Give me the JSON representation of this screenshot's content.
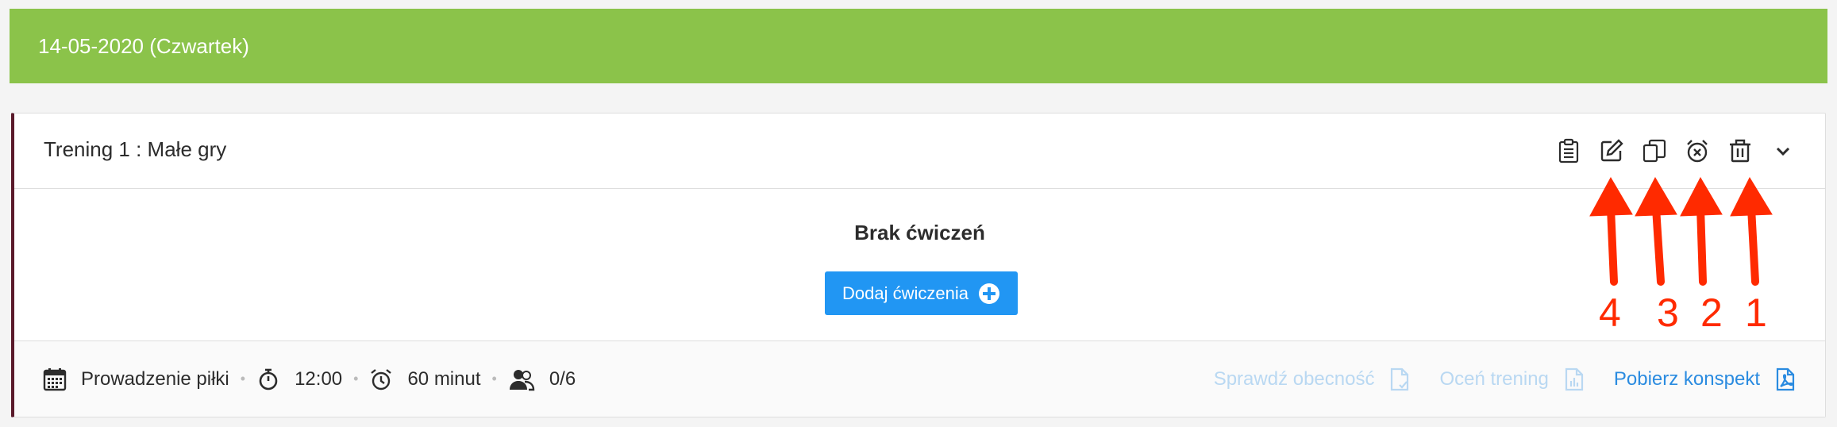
{
  "date_banner": {
    "text": "14-05-2020 (Czwartek)",
    "color": "#8bc34a"
  },
  "training": {
    "title": "Trening 1 : Małe gry",
    "accent_color": "#5a1a2b",
    "header_icons": [
      "clipboard-icon",
      "edit-icon",
      "copy-icon",
      "alarm-cancel-icon",
      "trash-icon",
      "chevron-down-icon"
    ],
    "empty_message": "Brak ćwiczeń",
    "add_button_label": "Dodaj ćwiczenia",
    "footer": {
      "category": "Prowadzenie piłki",
      "time": "12:00",
      "duration": "60 minut",
      "participants": "0/6",
      "check_attendance": "Sprawdź obecność",
      "rate_training": "Oceń trening",
      "download_plan": "Pobierz konspekt"
    }
  },
  "annotations": {
    "color": "#ff2a00",
    "labels": [
      "4",
      "3",
      "2",
      "1"
    ]
  }
}
